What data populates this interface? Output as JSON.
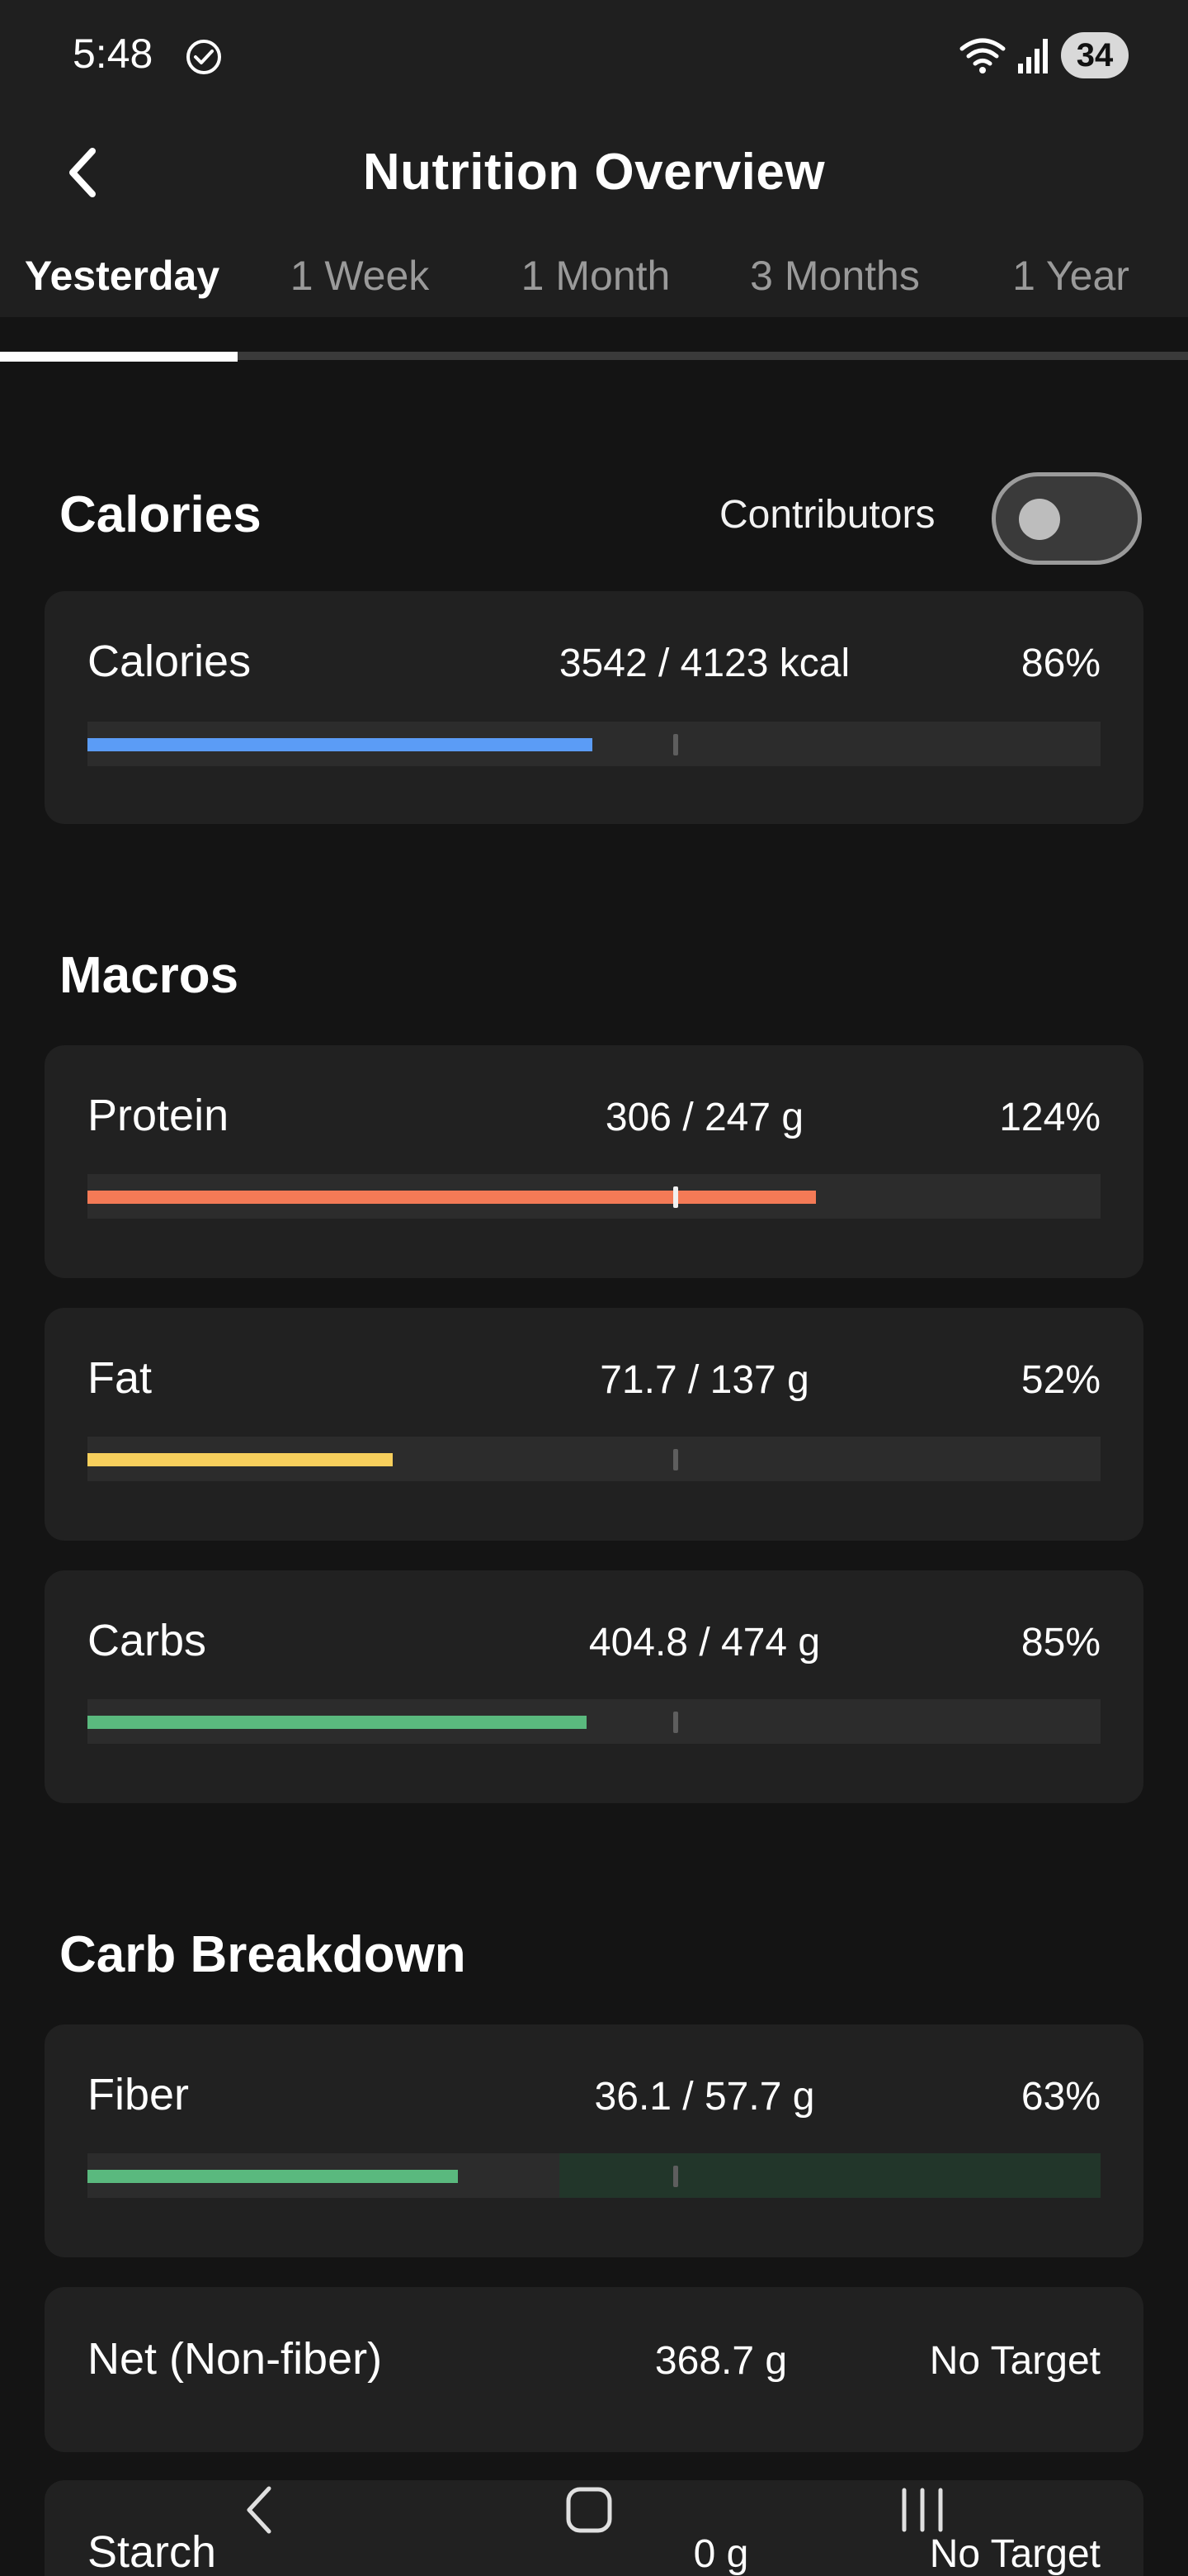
{
  "status_bar": {
    "time": "5:48",
    "battery": "34",
    "icons": [
      "check-circle-icon",
      "wifi-icon",
      "signal-icon",
      "battery-icon"
    ]
  },
  "header": {
    "title": "Nutrition Overview",
    "back_icon": "chevron-left-icon"
  },
  "tabs": [
    {
      "label": "Yesterday",
      "active": true
    },
    {
      "label": "1 Week",
      "active": false
    },
    {
      "label": "1 Month",
      "active": false
    },
    {
      "label": "3 Months",
      "active": false
    },
    {
      "label": "1 Year",
      "active": false
    }
  ],
  "calories_section": {
    "title": "Calories",
    "contributors_label": "Contributors",
    "contributors_on": false,
    "card": {
      "label": "Calories",
      "value": "3542 / 4123 kcal",
      "percent": "86%",
      "fill": 0.86,
      "color": "#5b9cf6"
    }
  },
  "macros_section": {
    "title": "Macros",
    "cards": [
      {
        "label": "Protein",
        "value": "306 / 247 g",
        "percent": "124%",
        "fill": 1.24,
        "color": "#f47a56"
      },
      {
        "label": "Fat",
        "value": "71.7 / 137 g",
        "percent": "52%",
        "fill": 0.52,
        "color": "#f7cf5c"
      },
      {
        "label": "Carbs",
        "value": "404.8 / 474 g",
        "percent": "85%",
        "fill": 0.85,
        "color": "#5ab97e"
      }
    ]
  },
  "carb_breakdown_section": {
    "title": "Carb Breakdown",
    "fiber": {
      "label": "Fiber",
      "value": "36.1 / 57.7 g",
      "percent": "63%",
      "fill": 0.63,
      "color": "#5ab97e"
    },
    "net": {
      "label": "Net (Non-fiber)",
      "value": "368.7 g",
      "target": "No Target"
    },
    "starch": {
      "label": "Starch",
      "value": "0 g",
      "target": "No Target"
    }
  },
  "nav_bar": {
    "icons": [
      "back-nav-icon",
      "home-nav-icon",
      "recents-nav-icon"
    ]
  }
}
